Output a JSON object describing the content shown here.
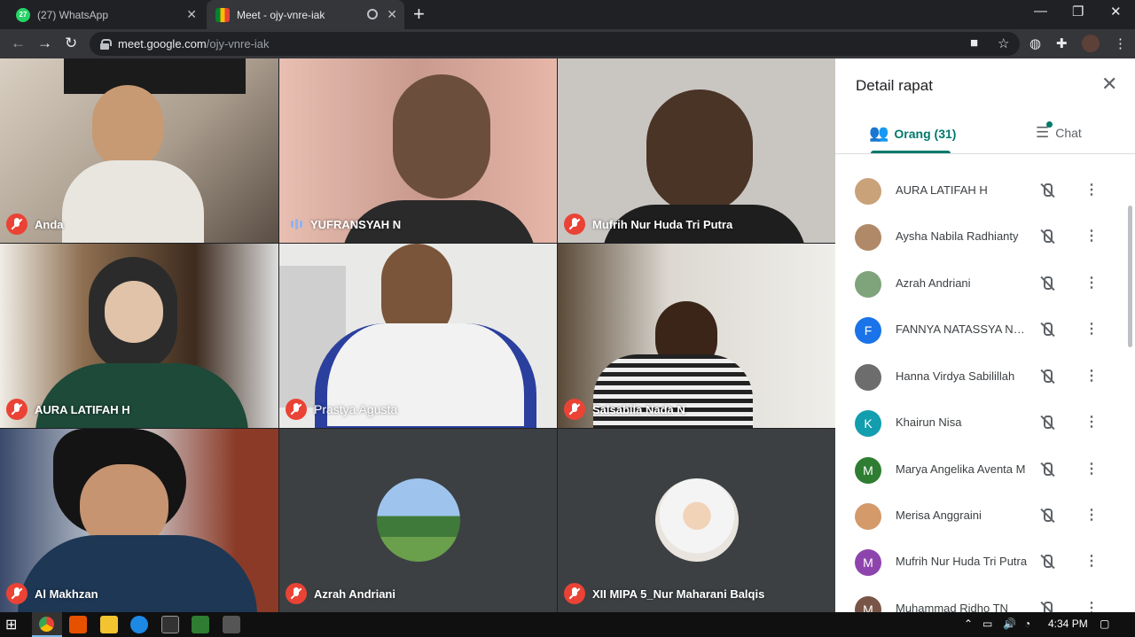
{
  "browser": {
    "tabs": [
      {
        "label": "(27) WhatsApp",
        "badge": "27"
      },
      {
        "label": "Meet - ojy-vnre-iak"
      }
    ],
    "url_host": "meet.google.com",
    "url_path": "/ojy-vnre-iak"
  },
  "tiles": [
    {
      "name": "Anda",
      "state": "muted"
    },
    {
      "name": "YUFRANSYAH N",
      "state": "speaking"
    },
    {
      "name": "Mufrih Nur Huda Tri Putra",
      "state": "muted"
    },
    {
      "name": "AURA LATIFAH H",
      "state": "muted"
    },
    {
      "name": "Prastya Agusta",
      "state": "muted"
    },
    {
      "name": "Salsabila Nada N",
      "state": "muted"
    },
    {
      "name": "Al Makhzan",
      "state": "muted"
    },
    {
      "name": "Azrah Andriani",
      "state": "muted"
    },
    {
      "name": "XII MIPA 5_Nur Maharani Balqis",
      "state": "muted"
    }
  ],
  "panel": {
    "title": "Detail rapat",
    "people_tab": "Orang (31)",
    "chat_tab": "Chat",
    "participants": [
      {
        "name": "AURA LATIFAH H",
        "initial": "",
        "color": "#c9a27a"
      },
      {
        "name": "Aysha Nabila Radhianty",
        "initial": "",
        "color": "#b08968"
      },
      {
        "name": "Azrah Andriani",
        "initial": "",
        "color": "#7fa37a"
      },
      {
        "name": "FANNYA NATASSYA NAT...",
        "initial": "F",
        "color": "#1a73e8"
      },
      {
        "name": "Hanna Virdya Sabilillah",
        "initial": "",
        "color": "#6d6d6d"
      },
      {
        "name": "Khairun Nisa",
        "initial": "K",
        "color": "#129eaf"
      },
      {
        "name": "Marya Angelika Aventa M",
        "initial": "M",
        "color": "#2e7d32"
      },
      {
        "name": "Merisa Anggraini",
        "initial": "",
        "color": "#d49a6a"
      },
      {
        "name": "Mufrih Nur Huda Tri Putra",
        "initial": "M",
        "color": "#8e44ad"
      },
      {
        "name": "Muhammad Ridho TN",
        "initial": "M",
        "color": "#795548"
      }
    ]
  },
  "taskbar": {
    "time": "4:34 PM"
  }
}
